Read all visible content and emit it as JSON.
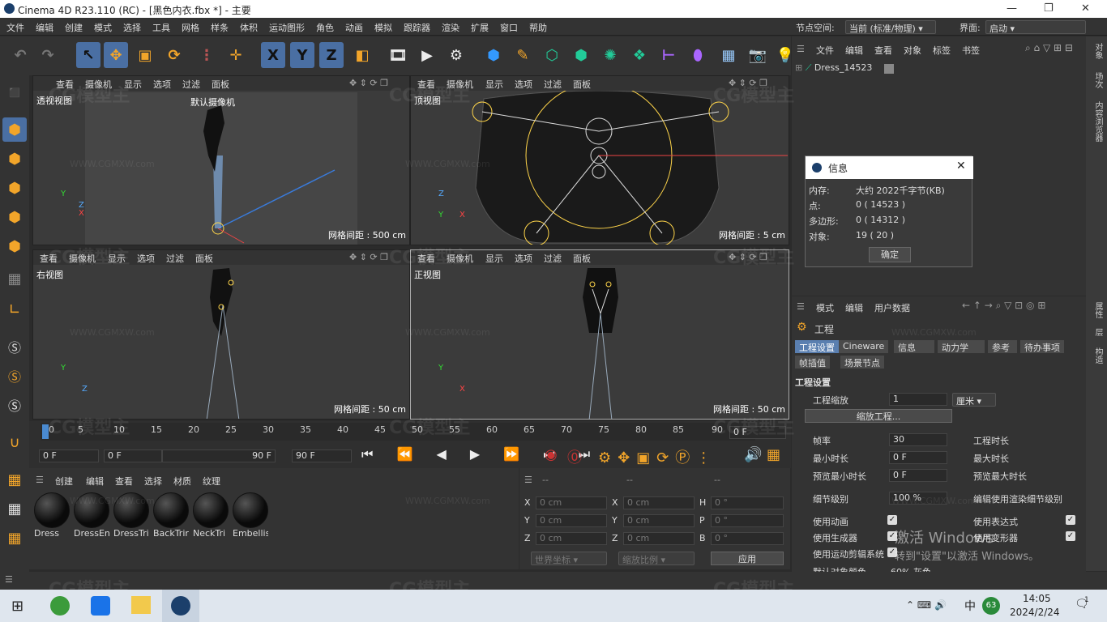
{
  "window": {
    "title": "Cinema 4D R23.110 (RC) - [黑色内衣.fbx *] - 主要"
  },
  "menu": {
    "items": [
      "文件",
      "编辑",
      "创建",
      "模式",
      "选择",
      "工具",
      "网格",
      "样条",
      "体积",
      "运动图形",
      "角色",
      "动画",
      "模拟",
      "跟踪器",
      "渲染",
      "扩展",
      "窗口",
      "帮助"
    ],
    "node_space_label": "节点空间:",
    "node_space_value": "当前 (标准/物理)",
    "layout_label": "界面:",
    "layout_value": "启动"
  },
  "toolbar": {
    "xyz": [
      "X",
      "Y",
      "Z"
    ]
  },
  "viewports": {
    "menu": [
      "查看",
      "摄像机",
      "显示",
      "选项",
      "过滤",
      "面板"
    ],
    "perspective": {
      "name": "透视视图",
      "camera": "默认摄像机",
      "grid": "网格间距 : 500 cm"
    },
    "top": {
      "name": "顶视图",
      "grid": "网格间距 : 5 cm"
    },
    "right": {
      "name": "右视图",
      "grid": "网格间距 : 50 cm"
    },
    "front": {
      "name": "正视图",
      "grid": "网格间距 : 50 cm"
    }
  },
  "timeline": {
    "ticks": [
      "0",
      "5",
      "10",
      "15",
      "20",
      "25",
      "30",
      "35",
      "40",
      "45",
      "50",
      "55",
      "60",
      "65",
      "70",
      "75",
      "80",
      "85",
      "90"
    ],
    "field_start": "0 F",
    "field_cur": "0 F",
    "field_end": "90 F",
    "field_max": "90 F",
    "end_frame": "0 F"
  },
  "materials": {
    "menu": [
      "创建",
      "编辑",
      "查看",
      "选择",
      "材质",
      "纹理"
    ],
    "items": [
      "Dress",
      "DressEn",
      "DressTri",
      "BackTrir",
      "NeckTri",
      "Embellis"
    ]
  },
  "coords": {
    "header": [
      "--",
      "--",
      "--"
    ],
    "rows": [
      {
        "a": "X",
        "av": "0 cm",
        "b": "X",
        "bv": "0 cm",
        "c": "H",
        "cv": "0 °"
      },
      {
        "a": "Y",
        "av": "0 cm",
        "b": "Y",
        "bv": "0 cm",
        "c": "P",
        "cv": "0 °"
      },
      {
        "a": "Z",
        "av": "0 cm",
        "b": "Z",
        "bv": "0 cm",
        "c": "B",
        "cv": "0 °"
      }
    ],
    "world": "世界坐标",
    "scale": "缩放比例",
    "apply": "应用"
  },
  "objects": {
    "menu": [
      "文件",
      "编辑",
      "查看",
      "对象",
      "标签",
      "书签"
    ],
    "item": "Dress_14523"
  },
  "info_dialog": {
    "title": "信息",
    "rows": [
      {
        "k": "内存:",
        "v": "大约 2022千字节(KB)"
      },
      {
        "k": "点:",
        "v": "0 ( 14523 )"
      },
      {
        "k": "多边形:",
        "v": "0 ( 14312 )"
      },
      {
        "k": "对象:",
        "v": "19 ( 20 )"
      }
    ],
    "ok": "确定"
  },
  "attributes": {
    "menu": [
      "模式",
      "编辑",
      "用户数据"
    ],
    "object": "工程",
    "tabs": [
      "工程设置",
      "Cineware",
      "信息",
      "动力学",
      "参考",
      "待办事项"
    ],
    "tabs2": [
      "帧插值",
      "场景节点"
    ],
    "section": "工程设置",
    "scale_label": "工程缩放",
    "scale_value": "1",
    "scale_unit": "厘米",
    "scale_btn": "缩放工程...",
    "fps_label": "帧率",
    "fps_value": "30",
    "len_label": "工程时长",
    "min_label": "最小时长",
    "min_value": "0 F",
    "max_label": "最大时长",
    "pmin_label": "预览最小时长",
    "pmin_value": "0 F",
    "pmax_label": "预览最大时长",
    "lod_label": "细节级别",
    "lod_value": "100 %",
    "lod_render": "编辑使用渲染细节级别",
    "anim": "使用动画",
    "expr": "使用表达式",
    "gen": "使用生成器",
    "deform": "使用变形器",
    "motion": "使用运动剪辑系统",
    "default_color": "默认对象颜色",
    "default_color_value": "60% 灰色"
  },
  "activation": {
    "line1": "激活 Windows",
    "line2": "转到\"设置\"以激活 Windows。"
  },
  "side_tabs": [
    "对象",
    "场次",
    "内容浏览器",
    "属性",
    "层",
    "构造"
  ],
  "taskbar": {
    "time": "14:05",
    "date": "2024/2/24",
    "ime": "中",
    "badge": "63",
    "notif": "1"
  },
  "watermark": {
    "logo": "CG模型主",
    "url": "WWW.CGMXW.com"
  }
}
